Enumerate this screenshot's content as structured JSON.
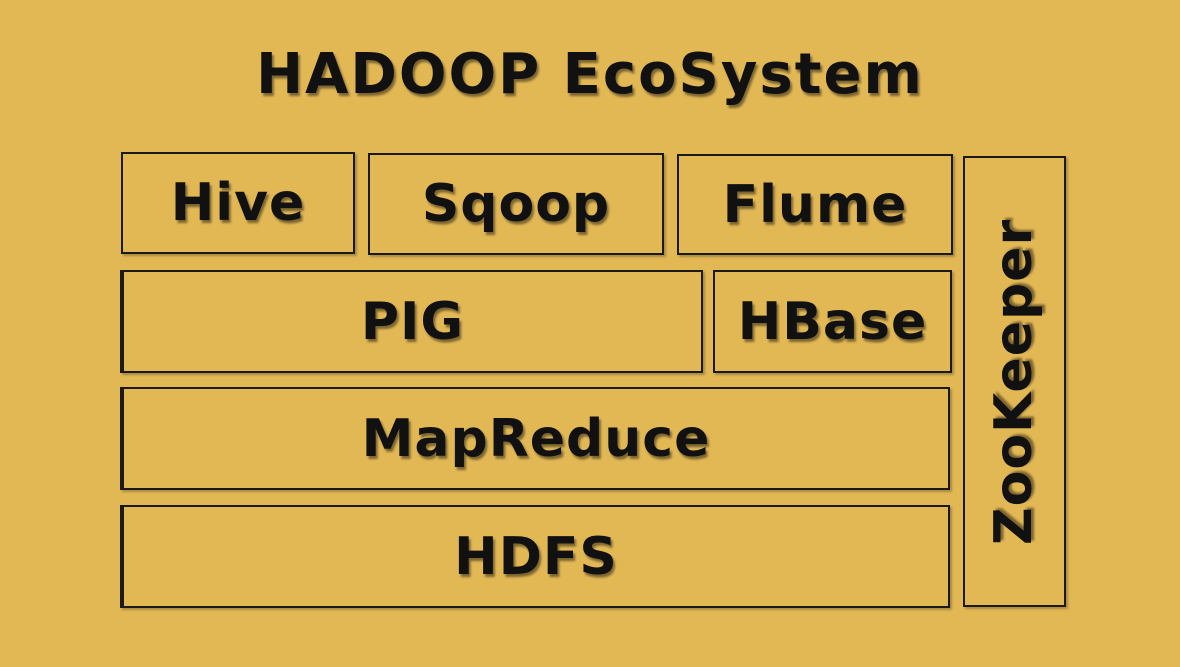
{
  "title": "HADOOP EcoSystem",
  "components": {
    "hive": "Hive",
    "sqoop": "Sqoop",
    "flume": "Flume",
    "pig": "PIG",
    "hbase": "HBase",
    "mapreduce": "MapReduce",
    "hdfs": "HDFS",
    "zookeeper": "ZooKeeper"
  },
  "colors": {
    "background": "#e2b855",
    "text": "#111111",
    "border": "#1a1a1a"
  }
}
